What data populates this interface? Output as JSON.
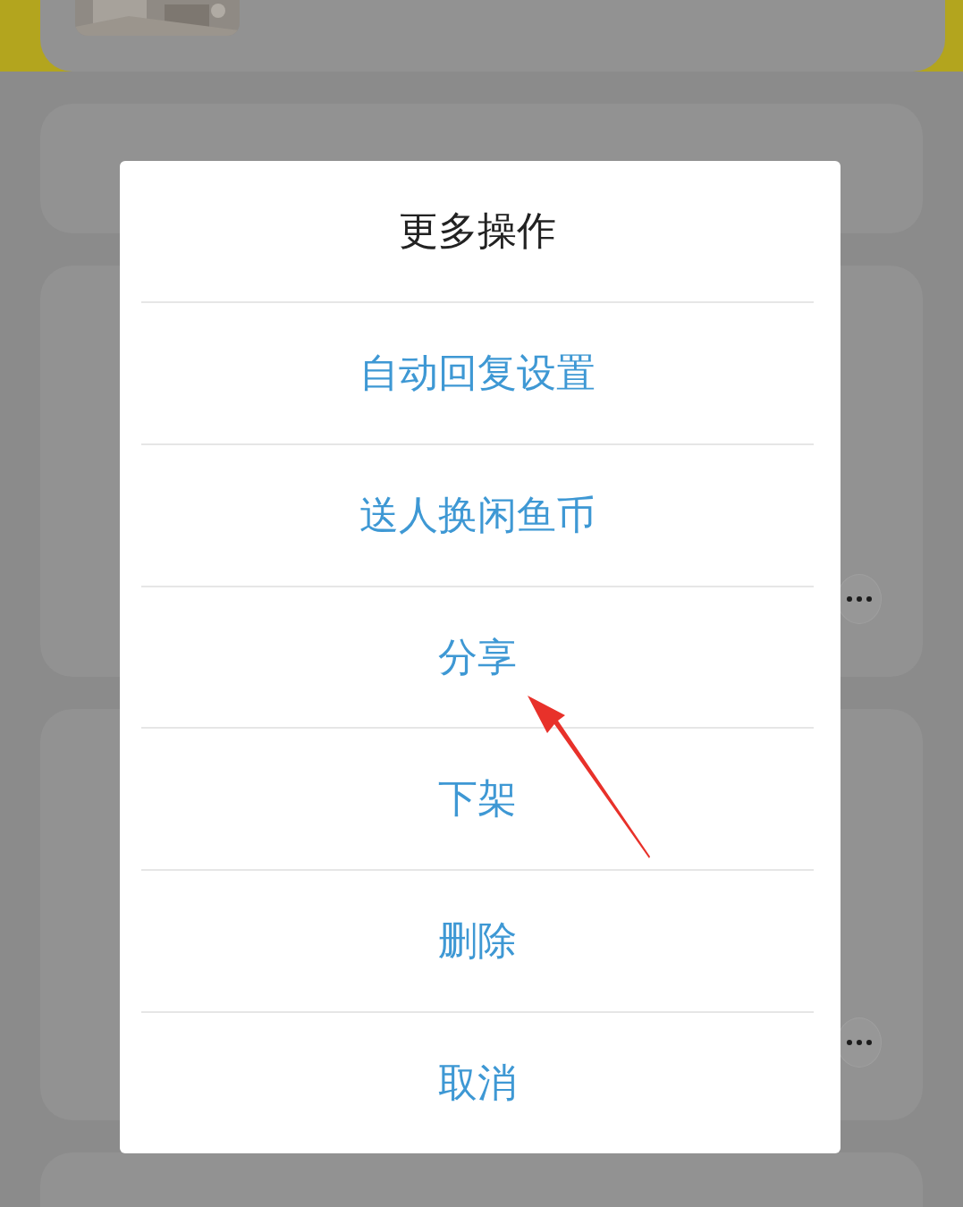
{
  "dialog": {
    "title": "更多操作",
    "options": [
      "自动回复设置",
      "送人换闲鱼币",
      "分享",
      "下架",
      "删除",
      "取消"
    ]
  }
}
